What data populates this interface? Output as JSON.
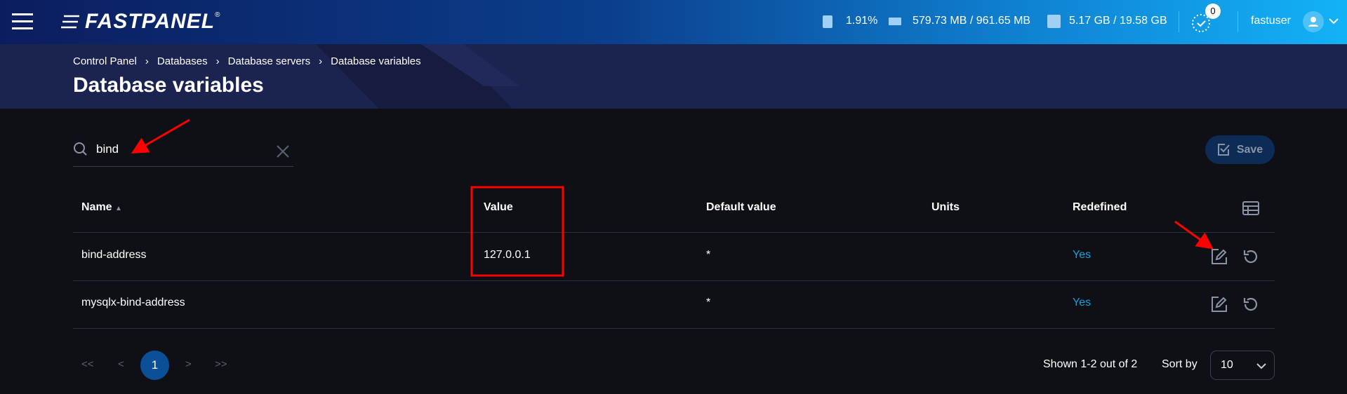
{
  "header": {
    "logo": "FASTPANEL",
    "cpu": "1.91%",
    "ram": "579.73 MB / 961.65 MB",
    "disk": "5.17 GB / 19.58 GB",
    "tasks_badge": "0",
    "username": "fastuser"
  },
  "breadcrumb": [
    "Control Panel",
    "Databases",
    "Database servers",
    "Database variables"
  ],
  "page_title": "Database variables",
  "search": {
    "value": "bind"
  },
  "toolbar": {
    "save_label": "Save"
  },
  "table": {
    "columns": [
      "Name",
      "Value",
      "Default value",
      "Units",
      "Redefined"
    ],
    "rows": [
      {
        "name": "bind-address",
        "value": "127.0.0.1",
        "default": "*",
        "units": "",
        "redefined": "Yes"
      },
      {
        "name": "mysqlx-bind-address",
        "value": "",
        "default": "*",
        "units": "",
        "redefined": "Yes"
      }
    ]
  },
  "pagination": {
    "first": "<<",
    "prev": "<",
    "current": "1",
    "next": ">",
    "last": ">>",
    "shown": "Shown 1-2 out of 2",
    "sort_label": "Sort by",
    "per_page": "10"
  },
  "colors": {
    "accent": "#1a9fe0",
    "save_bg": "#0c2c55",
    "annotation": "#ff0000"
  }
}
